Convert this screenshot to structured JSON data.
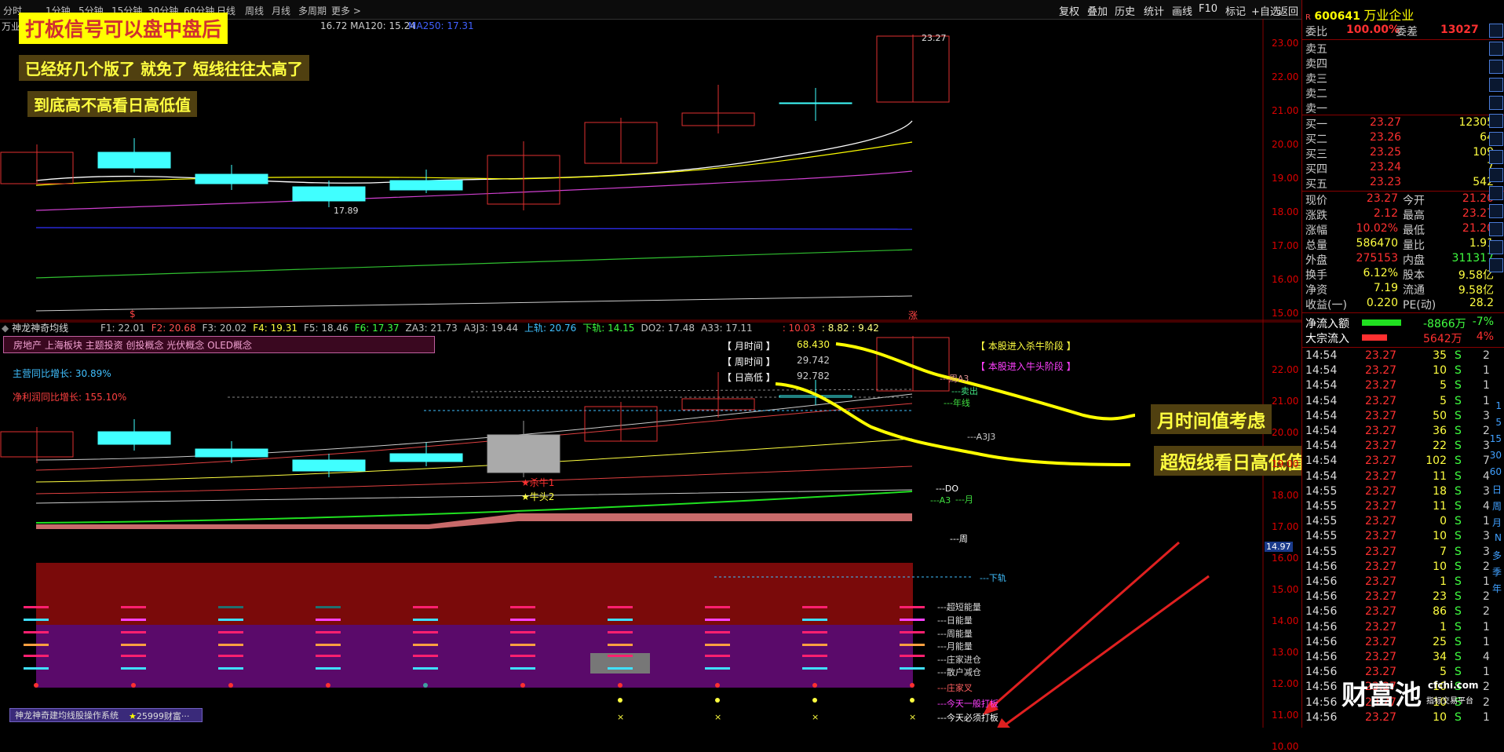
{
  "toolbar": {
    "periods": [
      "分时",
      "1分钟",
      "5分钟",
      "15分钟",
      "30分钟",
      "60分钟",
      "日线",
      "周线",
      "月线",
      "多周期",
      "更多 >"
    ],
    "right_buttons": [
      "复权",
      "叠加",
      "历史",
      "统计",
      "画线",
      "F10",
      "标记",
      "+自选",
      "返回"
    ]
  },
  "main_chart": {
    "stock_short": "万业",
    "ma_line": "16.72  MA120: 15.24",
    "ma250": "MA250: 17.31",
    "price_labels": [
      "23.00",
      "22.00",
      "21.00",
      "20.00",
      "19.00",
      "18.00",
      "17.00",
      "16.00",
      "15.00"
    ],
    "high_marker": "23.27",
    "low_marker": "17.89",
    "bottom_marker_left": "$",
    "bottom_marker_right": "涨"
  },
  "annotations": {
    "a1": "打板信号可以盘中盘后",
    "a2": "已经好几个版了   就免了   短线往往太高了",
    "a3": "到底高不高看日高低值",
    "a4": "月时间值考虑",
    "a5": "超短线看日高低值"
  },
  "indicator": {
    "name": "神龙神奇均线",
    "params": [
      {
        "t": "F1: 22.01",
        "c": "#c0c0c0"
      },
      {
        "t": "F2: 20.68",
        "c": "#ff5050"
      },
      {
        "t": "F3: 20.02",
        "c": "#c0c0c0"
      },
      {
        "t": "F4: 19.31",
        "c": "#ffff40"
      },
      {
        "t": "F5: 18.46",
        "c": "#c0c0c0"
      },
      {
        "t": "F6: 17.37",
        "c": "#40ff40"
      },
      {
        "t": "ZA3: 21.73",
        "c": "#c0c0c0"
      },
      {
        "t": "A3J3: 19.44",
        "c": "#c0c0c0"
      },
      {
        "t": "上轨: 20.76",
        "c": "#40c0ff"
      },
      {
        "t": "下轨: 14.15",
        "c": "#40ff40"
      },
      {
        "t": "DO2: 17.48",
        "c": "#c0c0c0"
      },
      {
        "t": "A33: 17.11",
        "c": "#c0c0c0"
      },
      {
        "t": ": 10.03",
        "c": "#ff4040"
      },
      {
        "t": ": 8.82 : 9.42",
        "c": "#ffff80"
      }
    ],
    "concepts": "房地产 上海板块 主题投资 创投概念 光伏概念 OLED概念",
    "revenue_growth": "主营同比增长: 30.89%",
    "profit_growth": "净利润同比增长: 155.10%",
    "month_time_label": "【 月时间 】",
    "month_time_value": "68.430",
    "week_time_label": "【 周时间 】",
    "week_time_value": "29.742",
    "day_hl_label": "【 日高低 】",
    "day_hl_value": "92.782",
    "phase_kill": "【 本股进入杀牛阶段 】",
    "phase_bull": "【 本股进入牛头阶段 】",
    "signal1": "★杀牛1",
    "signal2": "★牛头2",
    "line_labels": [
      "周A3",
      "卖出",
      "年线",
      "A3J3",
      "DO",
      "A3",
      "月",
      "周",
      "下轨",
      "超短能量",
      "日能量",
      "周能量",
      "月能量",
      "庄家进仓",
      "散户减仓",
      "庄家叉",
      "今天一般打板",
      "今天必须打板"
    ],
    "axis_labels": [
      "22.00",
      "21.00",
      "20.00",
      "19.00",
      "18.00",
      "17.00",
      "16.00",
      "15.00",
      "14.00",
      "13.00",
      "12.00",
      "11.00",
      "10.00"
    ],
    "low_value": "14.97",
    "footer_system": "神龙神奇建均线股操作系统",
    "footer_fortune": "25999财富···"
  },
  "quote": {
    "code": "600641",
    "name": "万业企业",
    "webi_label": "委比",
    "webi_value": "100.00%",
    "weicha_label": "委差",
    "weicha_value": "13027",
    "sells": [
      "卖五",
      "卖四",
      "卖三",
      "卖二",
      "卖一"
    ],
    "buys": [
      {
        "label": "买一",
        "price": "23.27",
        "vol": "12305"
      },
      {
        "label": "买二",
        "price": "23.26",
        "vol": "64"
      },
      {
        "label": "买三",
        "price": "23.25",
        "vol": "109"
      },
      {
        "label": "买四",
        "price": "23.24",
        "vol": "7"
      },
      {
        "label": "买五",
        "price": "23.23",
        "vol": "542"
      }
    ],
    "stats": [
      [
        "现价",
        "23.27",
        "今开",
        "21.20"
      ],
      [
        "涨跌",
        "2.12",
        "最高",
        "23.27"
      ],
      [
        "涨幅",
        "10.02%",
        "最低",
        "21.20"
      ],
      [
        "总量",
        "586470",
        "量比",
        "1.91"
      ],
      [
        "外盘",
        "275153",
        "内盘",
        "311317"
      ],
      [
        "换手",
        "6.12%",
        "股本",
        "9.58亿"
      ],
      [
        "净资",
        "7.19",
        "流通",
        "9.58亿"
      ],
      [
        "收益(一)",
        "0.220",
        "PE(动)",
        "28.2"
      ]
    ],
    "netflow_label": "净流入额",
    "netflow_value": "-8866万",
    "netflow_pct": "-7%",
    "block_label": "大宗流入",
    "block_value": "5642万",
    "block_pct": "4%",
    "ticks": [
      [
        "14:54",
        "23.27",
        "35",
        "S",
        "2"
      ],
      [
        "14:54",
        "23.27",
        "10",
        "S",
        "1"
      ],
      [
        "14:54",
        "23.27",
        "5",
        "S",
        "1"
      ],
      [
        "14:54",
        "23.27",
        "5",
        "S",
        "1"
      ],
      [
        "14:54",
        "23.27",
        "50",
        "S",
        "3"
      ],
      [
        "14:54",
        "23.27",
        "36",
        "S",
        "2"
      ],
      [
        "14:54",
        "23.27",
        "22",
        "S",
        "3"
      ],
      [
        "14:54",
        "23.27",
        "102",
        "S",
        "7"
      ],
      [
        "14:54",
        "23.27",
        "11",
        "S",
        "4"
      ],
      [
        "14:55",
        "23.27",
        "18",
        "S",
        "3"
      ],
      [
        "14:55",
        "23.27",
        "11",
        "S",
        "4"
      ],
      [
        "14:55",
        "23.27",
        "0",
        "S",
        "1"
      ],
      [
        "14:55",
        "23.27",
        "10",
        "S",
        "3"
      ],
      [
        "14:55",
        "23.27",
        "7",
        "S",
        "3"
      ],
      [
        "14:56",
        "23.27",
        "10",
        "S",
        "2"
      ],
      [
        "14:56",
        "23.27",
        "1",
        "S",
        "1"
      ],
      [
        "14:56",
        "23.27",
        "23",
        "S",
        "2"
      ],
      [
        "14:56",
        "23.27",
        "86",
        "S",
        "2"
      ],
      [
        "14:56",
        "23.27",
        "1",
        "S",
        "1"
      ],
      [
        "14:56",
        "23.27",
        "25",
        "S",
        "1"
      ],
      [
        "14:56",
        "23.27",
        "34",
        "S",
        "4"
      ],
      [
        "14:56",
        "23.27",
        "5",
        "S",
        "1"
      ],
      [
        "14:56",
        "23.27",
        "10",
        "S",
        "2"
      ],
      [
        "14:56",
        "23.27",
        "10",
        "S",
        "2"
      ],
      [
        "14:56",
        "23.27",
        "10",
        "S",
        "1"
      ]
    ],
    "sidebar_labels": [
      "1",
      "5",
      "15",
      "30",
      "60",
      "日",
      "周",
      "月",
      "N",
      "多",
      "季",
      "年"
    ],
    "watermark_main": "财富池",
    "watermark_site": "cfchi.com",
    "watermark_sub": "指标交易平台"
  }
}
